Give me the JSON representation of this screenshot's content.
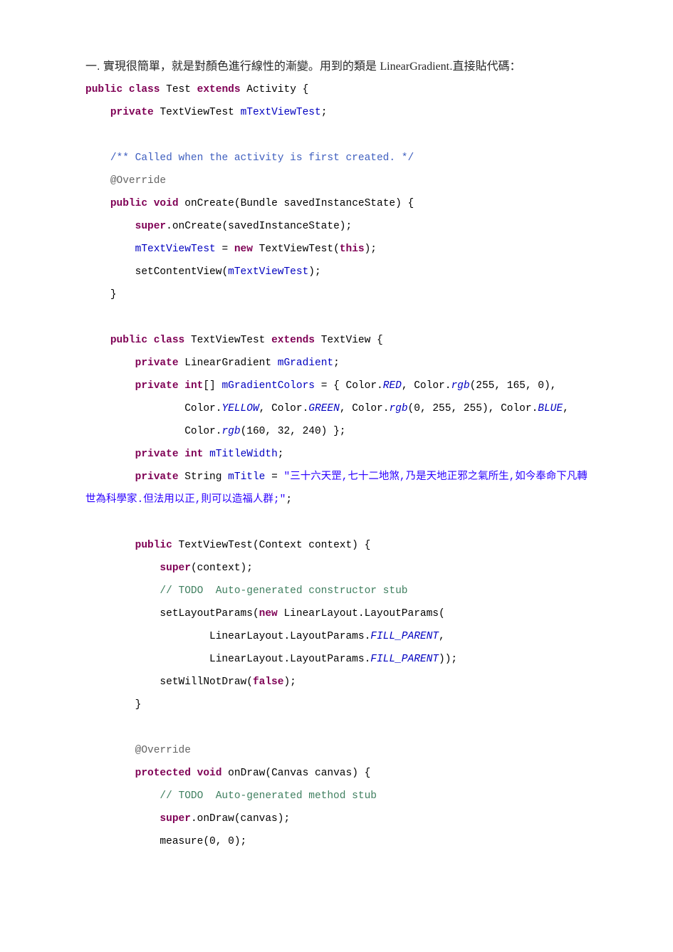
{
  "intro": {
    "part1": "一. 實現很簡單，就是對顏色進行線性的漸變。用到的類是 ",
    "class": "LinearGradient",
    "part2": ".直接貼代碼："
  },
  "c": {
    "public": "public",
    "class": "class",
    "extends": "extends",
    "private": "private",
    "void": "void",
    "new": "new",
    "this": "this",
    "super": "super",
    "int_arr": "int",
    "false": "false",
    "protected": "protected",
    "Test": "Test",
    "Activity": "Activity",
    "TextViewTest": "TextViewTest",
    "mTextViewTest": "mTextViewTest",
    "doc_comment": "/** Called when the activity is first created. */",
    "override": "@Override",
    "onCreate": "onCreate",
    "bundle_sig": "(Bundle savedInstanceState) {",
    "super_onCreate": ".onCreate(savedInstanceState);",
    "assign_tv": " = ",
    "tv_ctor": " TextViewTest(",
    "tv_ctor_end": ");",
    "setContentView": "setContentView(",
    "close_paren_semi": ");",
    "TextView": "TextView",
    "LinearGradient": " LinearGradient ",
    "mGradient": "mGradient",
    "mGradientColors": "mGradientColors",
    "arr_open": "[] ",
    "eq_brace": " = { Color.",
    "RED": "RED",
    "rgb": "rgb",
    "c1": ", Color.",
    "rgb1_args": "(255, 165, 0),",
    "indent_line2_a": "                Color.",
    "YELLOW": "YELLOW",
    "GREEN": "GREEN",
    "rgb2_args": "(0, 255, 255), Color.",
    "BLUE": "BLUE",
    "comma": ",",
    "indent_line3_a": "                Color.",
    "rgb3_args": "(160, 32, 240) };",
    "mTitleWidth": "mTitleWidth",
    "String": " String ",
    "mTitle": "mTitle",
    "eq": " = ",
    "title_str": "\"三十六天罡,七十二地煞,乃是天地正邪之氣所生,如今奉命下凡轉世為科學家.但法用以正,則可以造福人群;\"",
    "semi": ";",
    "ctor_sig": " TextViewTest(Context context) {",
    "super_ctx": "(context);",
    "todo_ctor": "// TODO  Auto-generated constructor stub",
    "setLayoutParams": "setLayoutParams(",
    "ll_lp": " LinearLayout.LayoutParams(",
    "ll_pfx": "                    LinearLayout.LayoutParams.",
    "FILL_PARENT": "FILL_PARENT",
    "end_paren2": "));",
    "setWillNotDraw": "setWillNotDraw(",
    "onDraw": "onDraw",
    "ondraw_sig": "(Canvas canvas) {",
    "todo_method": "// TODO  Auto-generated method stub",
    "super_onDraw": ".onDraw(canvas);",
    "measure": "measure(0, 0);"
  }
}
